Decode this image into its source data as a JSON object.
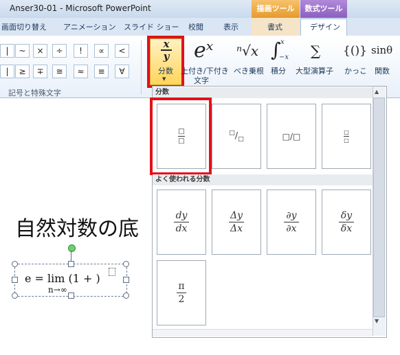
{
  "window": {
    "title": "Anser30-01 - Microsoft PowerPoint",
    "contextual_tabs": [
      "描画ツール",
      "数式ツール"
    ]
  },
  "tabs": [
    "画面切り替え",
    "アニメーション",
    "スライド ショー",
    "校閲",
    "表示",
    "書式",
    "デザイン"
  ],
  "ribbon": {
    "symbols_row1": [
      "|",
      "~",
      "×",
      "÷",
      "!",
      "∝",
      "<"
    ],
    "symbols_row2": [
      "|",
      "≥",
      "∓",
      "≅",
      "≈",
      "≡",
      "∀"
    ],
    "symbols_group_label": "記号と特殊文字",
    "buttons": {
      "fraction": {
        "icon_top": "x",
        "icon_bottom": "y",
        "label": "分数"
      },
      "script": {
        "icon": "eˣ",
        "label1": "上付き/下付き",
        "label2": "文字"
      },
      "radical": {
        "icon": "ⁿ√x",
        "label": "べき乗根"
      },
      "integral": {
        "icon": "∫",
        "label": "積分"
      },
      "large_operator": {
        "icon": "∑",
        "label": "大型演算子"
      },
      "bracket": {
        "icon": "{()}",
        "label": "かっこ"
      },
      "function": {
        "icon": "sinθ",
        "label": "関数"
      }
    }
  },
  "slide": {
    "title": "自然対数の底",
    "equation": "e =  lim (1 + )",
    "equation_sub": "n→∞"
  },
  "gallery": {
    "section1": "分数",
    "section2": "よく使われる分数",
    "fraction_styles": [
      "stacked",
      "skewed",
      "linear",
      "small"
    ],
    "common": [
      {
        "num": "dy",
        "den": "dx"
      },
      {
        "num": "Δy",
        "den": "Δx"
      },
      {
        "num": "∂y",
        "den": "∂x"
      },
      {
        "num": "δy",
        "den": "δx"
      },
      {
        "num": "π",
        "den": "2"
      }
    ]
  },
  "colors": {
    "highlight": "#e4101a",
    "active_button": "#ffd55a"
  }
}
